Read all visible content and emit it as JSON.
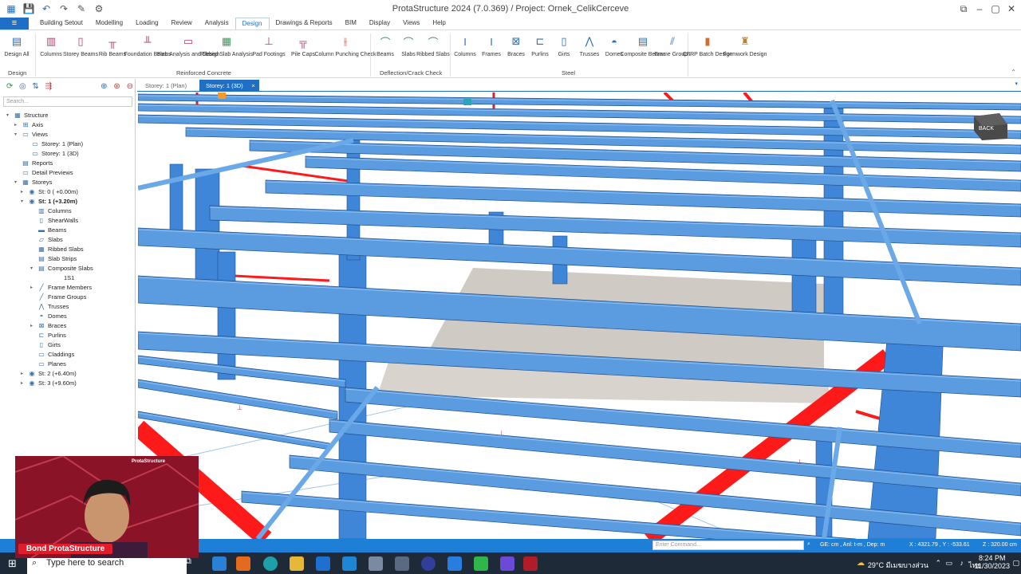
{
  "title": "ProtaStructure 2024 (7.0.369) / Project: Ornek_CelikCerceve",
  "file_label": "≡",
  "menu": [
    "Building Setout",
    "Modelling",
    "Loading",
    "Review",
    "Analysis",
    "Design",
    "Drawings & Reports",
    "BIM",
    "Display",
    "Views",
    "Help"
  ],
  "ribbon": {
    "buttons": [
      "Design All",
      "Columns",
      "Storey Beams",
      "Rib Beams",
      "Foundation Beams",
      "Slab Analysis and Design",
      "Ribbed Slab Analysis",
      "Pad Footings",
      "Pile Caps",
      "Column Punching Check",
      "Beams",
      "Slabs",
      "Ribbed Slabs",
      "Columns",
      "Frames",
      "Braces",
      "Purlins",
      "Girts",
      "Trusses",
      "Domes",
      "Composite Beams",
      "Frame Groups",
      "CFRP Batch Design",
      "Formwork Design"
    ],
    "groups": [
      "Design",
      "Reinforced Concrete",
      "Deflection/Crack Check",
      "Steel"
    ]
  },
  "search_placeholder": "Search...",
  "tree": [
    "Structure",
    "Axis",
    "Views",
    "Storey: 1 (Plan)",
    "Storey: 1 (3D)",
    "Reports",
    "Detail Previews",
    "Storeys",
    "St: 0 ( +0.00m)",
    "St: 1 (+3.20m)",
    "Columns",
    "ShearWalls",
    "Beams",
    "Slabs",
    "Ribbed Slabs",
    "Slab Strips",
    "Composite Slabs",
    "1S1",
    "Frame Members",
    "Frame Groups",
    "Trusses",
    "Domes",
    "Braces",
    "Purlins",
    "Girts",
    "Claddings",
    "Planes",
    "St: 2 (+6.40m)",
    "St: 3 (+9.60m)"
  ],
  "tabs": [
    "Storey: 1 (Plan)",
    "Storey: 1 (3D)"
  ],
  "tab_close": "×",
  "viewcube": "BACK",
  "status": {
    "command_placeholder": "Enter Command...",
    "units": "GE: cm , Anl: t-m , Dep: m",
    "coords": "X : 4321.79 , Y : -533.61",
    "z": "Z : 320.00 cm"
  },
  "taskbar": {
    "search": "Type here to search",
    "weather": "29°C  มีเมฆบางส่วน",
    "lang": "ไทย",
    "time": "8:24 PM",
    "date": "11/30/2023"
  },
  "webcam": {
    "name": "Bond ProtaStructure",
    "brand": "ProtaStructure"
  },
  "colors": {
    "accent": "#1e6fc5",
    "steel": "#5b9be0",
    "brace": "#ff1a1a"
  }
}
